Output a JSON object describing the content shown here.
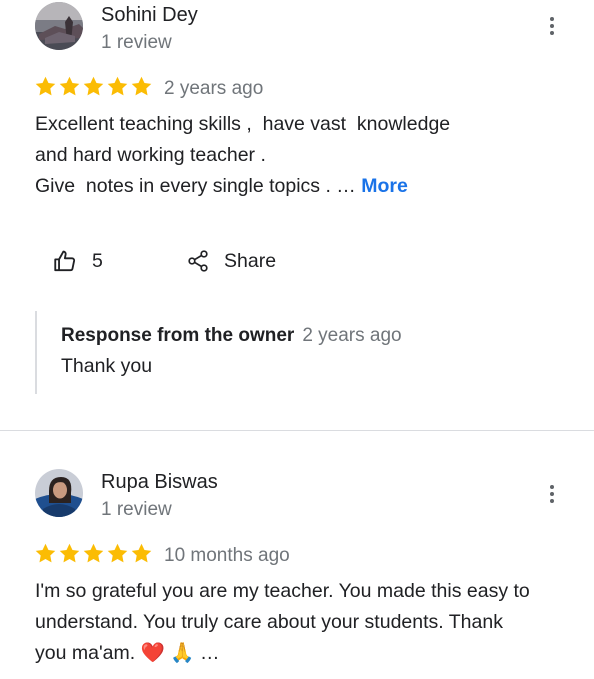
{
  "reviews": [
    {
      "name": "Sohini Dey",
      "review_count": "1 review",
      "rating": 5,
      "date": "2 years ago",
      "text_lines": [
        "Excellent teaching skills ,  have vast  knowledge",
        "and hard working teacher .",
        "Give  notes in every single topics . … "
      ],
      "more_label": "More",
      "like_count": "5",
      "share_label": "Share",
      "response": {
        "label": "Response from the owner",
        "date": "2 years ago",
        "text": "Thank you"
      }
    },
    {
      "name": "Rupa Biswas",
      "review_count": "1 review",
      "rating": 5,
      "date": "10 months ago",
      "text_lines": [
        "I'm so grateful you are my teacher. You made this easy to",
        "understand. You truly care about your students. Thank",
        "you ma'am. "
      ],
      "emoji": [
        "❤️",
        "🙏"
      ],
      "ellipsis": "…"
    }
  ],
  "colors": {
    "star": "#fbbc04",
    "link": "#1a73e8",
    "secondary_text": "#70757a",
    "divider": "#dadce0"
  }
}
